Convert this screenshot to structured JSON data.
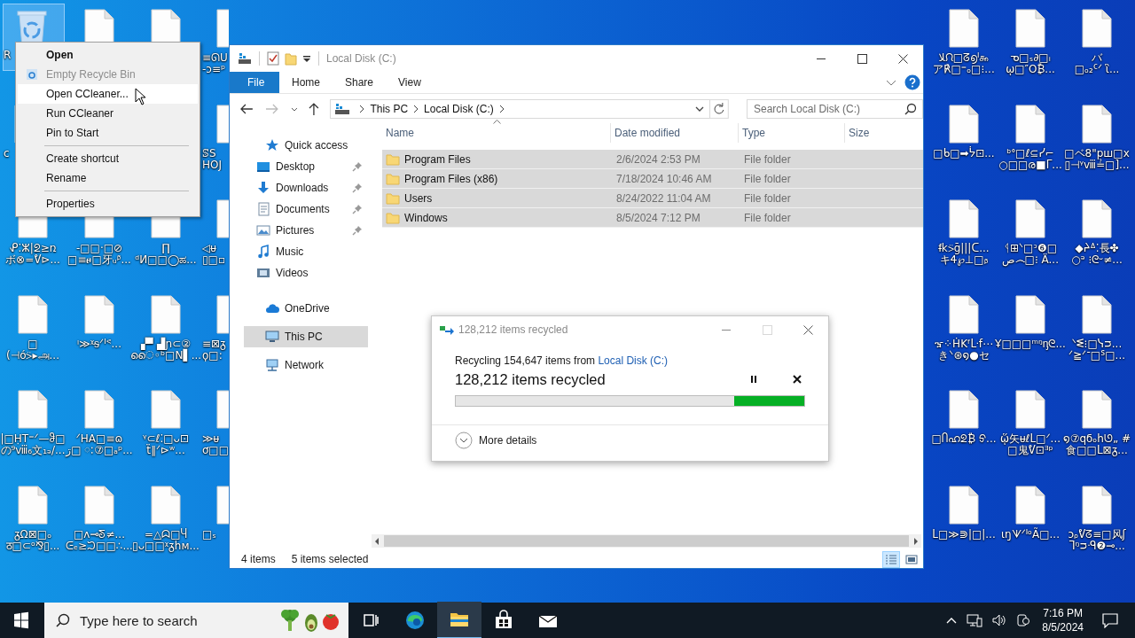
{
  "desktop": {
    "left_columns": [
      [
        {
          "kind": "recycle-bin",
          "selected": true,
          "clipped": true,
          "label_lines": [
            "R"
          ]
        },
        {
          "kind": "file",
          "clipped": true,
          "label_lines": [
            "c"
          ]
        },
        {
          "kind": "file",
          "label_lines": [
            "ᕵ⁚ⵣ|ᘖ≥ռ",
            "ボ⊗=ᕓ⊳..."
          ]
        },
        {
          "kind": "file",
          "label_lines": [
            "□",
            "(⊣ό⍩▸அ..."
          ]
        },
        {
          "kind": "file",
          "label_lines": [
            "|□ḤT⁼ᐟ—ჵ□",
            "の⁹ⅷ₆文₁ₔ/..."
          ]
        },
        {
          "kind": "file",
          "label_lines": [
            "ᵹΩ⊠□ₒ",
            "ठ□⊂ᵒ⅋▯..."
          ]
        }
      ],
      [
        {
          "kind": "file"
        },
        {
          "kind": "covered"
        },
        {
          "kind": "file",
          "label_lines": [
            "-□□·□⊘",
            "□≡ፀ□牙ᵤᵝ..."
          ]
        },
        {
          "kind": "file",
          "label_lines": [
            "ᵎ≫ᵡᵴᐟᑊᕝ..."
          ]
        },
        {
          "kind": "file",
          "label_lines": [
            "ᐟHA□≡ɷ",
            "ڗ□ ៈ⑦□ₐᵖ..."
          ]
        },
        {
          "kind": "file",
          "label_lines": [
            "□ʌ⊸ᘕ≠...",
            "ᕮₑ≥ᙂ□□∴..."
          ]
        }
      ],
      [
        {
          "kind": "file"
        },
        {
          "kind": "covered"
        },
        {
          "kind": "file",
          "label_lines": [
            "∏",
            "ᵈⵍ□□◯ಹ..."
          ]
        },
        {
          "kind": "file",
          "label_lines": [
            "▞▘▟ɲ⊂②",
            "ൈ◦ᵇ□N▌..."
          ]
        },
        {
          "kind": "file",
          "label_lines": [
            "ᵞ⊂ℓ⁚□ᴗ⊡",
            "ẗ∥ᐟ⊳ʷ..."
          ]
        },
        {
          "kind": "file",
          "label_lines": [
            "=△ᗣ□Ⴗ",
            "▯ᴗ□□ᵡᵹhм..."
          ]
        }
      ]
    ],
    "partial_column": [
      {
        "kind": "file",
        "clipped": true,
        "label_lines": [
          "≡ᘏU",
          "-ɔ≡ᵖ"
        ]
      },
      {
        "kind": "file",
        "clipped": true,
        "label_lines": [
          "ꕷS",
          "HOJ"
        ]
      },
      {
        "kind": "file",
        "clipped": true,
        "label_lines": [
          "◁ᵾ",
          "▯□▫"
        ]
      },
      {
        "kind": "file",
        "clipped": true,
        "label_lines": [
          "≡⊠ᵹ",
          "ϙ□:"
        ]
      },
      {
        "kind": "file",
        "clipped": true,
        "label_lines": [
          "≫ᵾ",
          "ơ□□"
        ]
      },
      {
        "kind": "file",
        "clipped": true,
        "label_lines": [
          "□ₛ"
        ]
      }
    ],
    "right_columns": [
      [
        {
          "kind": "file",
          "label_lines": [
            "ﻼᙁ□ᘔ൭ᑊ௯",
            "ア℟□⁼ₒ□⁝..."
          ]
        },
        {
          "kind": "file",
          "label_lines": [
            "□ᑲ□➡ᔮ⊡..."
          ]
        },
        {
          "kind": "file",
          "label_lines": [
            "ᵮk⍩ḡ|||ᑕ...",
            "キᏎ℘⊥□ᵦ"
          ]
        },
        {
          "kind": "file",
          "label_lines": [
            "ኇ⁘ḢKᶠᒷf⋯",
            "きᐠ⊛໑●セ"
          ]
        },
        {
          "kind": "file",
          "label_lines": [
            "□Ⴖഹᘖ₿ ᢒ..."
          ]
        },
        {
          "kind": "file",
          "label_lines": [
            "ᒪ□≫⋑|□|..."
          ]
        }
      ],
      [
        {
          "kind": "file",
          "label_lines": [
            "ᓀ□ₛ∂□ᵢ",
            "ῳ□″O₿..."
          ]
        },
        {
          "kind": "file",
          "label_lines": [
            "ᵇᐤ□ℓ⊆ᓯ⌐",
            "○□□ര■ᒥ..."
          ]
        },
        {
          "kind": "file",
          "label_lines": [
            "ᛩ⊞ᐠ□ᵓ❻□",
            "ص෴□⁝ Ä..."
          ]
        },
        {
          "kind": "file",
          "label_lines": [
            "Ұ□□□ᵐᵑᶇᘓ..."
          ]
        },
        {
          "kind": "file",
          "label_lines": [
            "ᾥ矢ᵾℓᒪ□ᐟ...",
            "□鬼ᕓ⊡ᴲᵖ"
          ]
        },
        {
          "kind": "file",
          "label_lines": [
            "ɩŋᗐᐟᑊᵒÃ□..."
          ]
        }
      ],
      [
        {
          "kind": "file",
          "label_lines": [
            "バ",
            "□ₒ₂ᑦᐟ ἳ..."
          ]
        },
        {
          "kind": "file",
          "label_lines": [
            "□ベ8\"pш□x",
            "▯⊣ᵞⅷ≟□]..."
          ]
        },
        {
          "kind": "file",
          "label_lines": [
            "◆ᔨᐞ⁚長✤",
            "○ᵊ ⁝ᘓᵕ≠..."
          ]
        },
        {
          "kind": "file",
          "label_lines": [
            "ᐠᓬ⁝□ᓭᴝ...",
            "ᐟ≧ᐟᐨ□ᔆ□..."
          ]
        },
        {
          "kind": "file",
          "label_lines": [
            "໑⑦qϭₒhᘎ„ #",
            "食□□ᒪ⊠ᵹ..."
          ]
        },
        {
          "kind": "file",
          "label_lines": [
            "ᴐᵨᕓᘔ≡□风ʃ",
            "ᒣᵑᴝᑴ❷⊸..."
          ]
        }
      ]
    ]
  },
  "context_menu": {
    "items": [
      {
        "kind": "item",
        "label": "Open",
        "default": true,
        "disabled": false,
        "highlighted": false,
        "has_icon": false
      },
      {
        "kind": "item",
        "label": "Empty Recycle Bin",
        "default": false,
        "disabled": true,
        "highlighted": false,
        "has_icon": true
      },
      {
        "kind": "item",
        "label": "Open CCleaner...",
        "default": false,
        "disabled": false,
        "highlighted": true,
        "has_icon": false
      },
      {
        "kind": "item",
        "label": "Run CCleaner",
        "default": false,
        "disabled": false,
        "highlighted": false,
        "has_icon": false
      },
      {
        "kind": "item",
        "label": "Pin to Start",
        "default": false,
        "disabled": false,
        "highlighted": false,
        "has_icon": false
      },
      {
        "kind": "separator"
      },
      {
        "kind": "item",
        "label": "Create shortcut",
        "default": false,
        "disabled": false,
        "highlighted": false,
        "has_icon": false
      },
      {
        "kind": "item",
        "label": "Rename",
        "default": false,
        "disabled": false,
        "highlighted": false,
        "has_icon": false
      },
      {
        "kind": "separator"
      },
      {
        "kind": "item",
        "label": "Properties",
        "default": false,
        "disabled": false,
        "highlighted": false,
        "has_icon": false
      }
    ]
  },
  "explorer": {
    "title": "Local Disk (C:)",
    "ribbon_tabs": [
      {
        "label": "File",
        "kind": "file"
      },
      {
        "label": "Home",
        "kind": "tab"
      },
      {
        "label": "Share",
        "kind": "tab"
      },
      {
        "label": "View",
        "kind": "tab"
      }
    ],
    "breadcrumb": [
      "This PC",
      "Local Disk (C:)"
    ],
    "search": {
      "placeholder": "Search Local Disk (C:)"
    },
    "nav": [
      {
        "label": "Quick access",
        "kind": "star",
        "selected": false,
        "children": [
          {
            "label": "Desktop",
            "kind": "desktop",
            "pinned": true,
            "selected": false
          },
          {
            "label": "Downloads",
            "kind": "downloads",
            "pinned": true,
            "selected": false
          },
          {
            "label": "Documents",
            "kind": "documents",
            "pinned": true,
            "selected": false
          },
          {
            "label": "Pictures",
            "kind": "pictures",
            "pinned": true,
            "selected": false
          },
          {
            "label": "Music",
            "kind": "music",
            "pinned": false,
            "selected": false
          },
          {
            "label": "Videos",
            "kind": "videos",
            "pinned": false,
            "selected": false
          }
        ]
      },
      {
        "label": "OneDrive",
        "kind": "cloud",
        "selected": false
      },
      {
        "label": "This PC",
        "kind": "pc",
        "selected": true
      },
      {
        "label": "Network",
        "kind": "network",
        "selected": false
      }
    ],
    "columns": [
      {
        "label": "Name",
        "sorted": true
      },
      {
        "label": "Date modified",
        "sorted": false
      },
      {
        "label": "Type",
        "sorted": false
      },
      {
        "label": "Size",
        "sorted": false
      }
    ],
    "rows": [
      {
        "name": "Program Files",
        "date": "2/6/2024 2:53 PM",
        "type": "File folder",
        "selected": true
      },
      {
        "name": "Program Files (x86)",
        "date": "7/18/2024 10:46 AM",
        "type": "File folder",
        "selected": true
      },
      {
        "name": "Users",
        "date": "8/24/2022 11:04 AM",
        "type": "File folder",
        "selected": true
      },
      {
        "name": "Windows",
        "date": "8/5/2024 7:12 PM",
        "type": "File folder",
        "selected": true
      }
    ],
    "status": {
      "count": "4 items",
      "selection": "5 items selected"
    },
    "view_buttons": [
      {
        "kind": "details",
        "selected": true
      },
      {
        "kind": "thumbnails",
        "selected": false
      }
    ]
  },
  "dialog": {
    "title": "128,212 items recycled",
    "message": "Recycling 154,647 items from ",
    "source_link": "Local Disk (C:)",
    "progress_text": "128,212 items recycled",
    "progress": {
      "level": 0.2
    },
    "more_details": "More details"
  },
  "taskbar": {
    "search_placeholder": "Type here to search",
    "apps": [
      {
        "kind": "task-view",
        "active": false
      },
      {
        "kind": "edge",
        "active": false
      },
      {
        "kind": "explorer",
        "active": true
      },
      {
        "kind": "store",
        "active": false
      },
      {
        "kind": "mail",
        "active": false
      }
    ],
    "clock": {
      "time": "7:16 PM",
      "date": "8/5/2024"
    }
  }
}
